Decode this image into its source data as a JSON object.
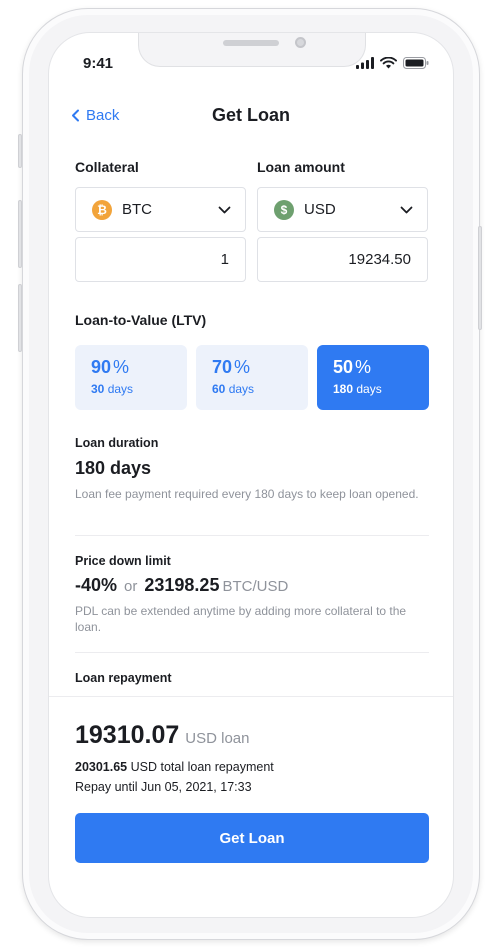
{
  "status_bar": {
    "time": "9:41"
  },
  "header": {
    "back_label": "Back",
    "title": "Get Loan"
  },
  "collateral": {
    "label": "Collateral",
    "currency": "BTC",
    "coin_symbol": "₿",
    "amount": "1"
  },
  "loan_amount": {
    "label": "Loan amount",
    "currency": "USD",
    "coin_symbol": "$",
    "amount": "19234.50"
  },
  "ltv": {
    "label": "Loan-to-Value (LTV)",
    "options": [
      {
        "percent": "90",
        "unit": "%",
        "days_num": "30",
        "days_word": "days",
        "selected": false
      },
      {
        "percent": "70",
        "unit": "%",
        "days_num": "60",
        "days_word": "days",
        "selected": false
      },
      {
        "percent": "50",
        "unit": "%",
        "days_num": "180",
        "days_word": "days",
        "selected": true
      }
    ]
  },
  "duration": {
    "label": "Loan duration",
    "value": "180 days",
    "hint": "Loan fee payment required every 180 days to keep loan opened."
  },
  "pdl": {
    "label": "Price down limit",
    "percent": "-40%",
    "or": "or",
    "price": "23198.25",
    "pair": "BTC/USD",
    "hint": "PDL can be extended anytime by adding more collateral to the loan."
  },
  "repayment": {
    "label": "Loan repayment",
    "amount": "19310.07",
    "amount_unit": "USD loan",
    "total_amount": "20301.65",
    "total_text": "USD total loan repayment",
    "repay_until": "Repay until Jun 05, 2021, 17:33"
  },
  "cta": {
    "label": "Get Loan"
  },
  "colors": {
    "accent": "#2f7af2",
    "btc": "#f2a43b",
    "usd": "#6ea06f"
  }
}
